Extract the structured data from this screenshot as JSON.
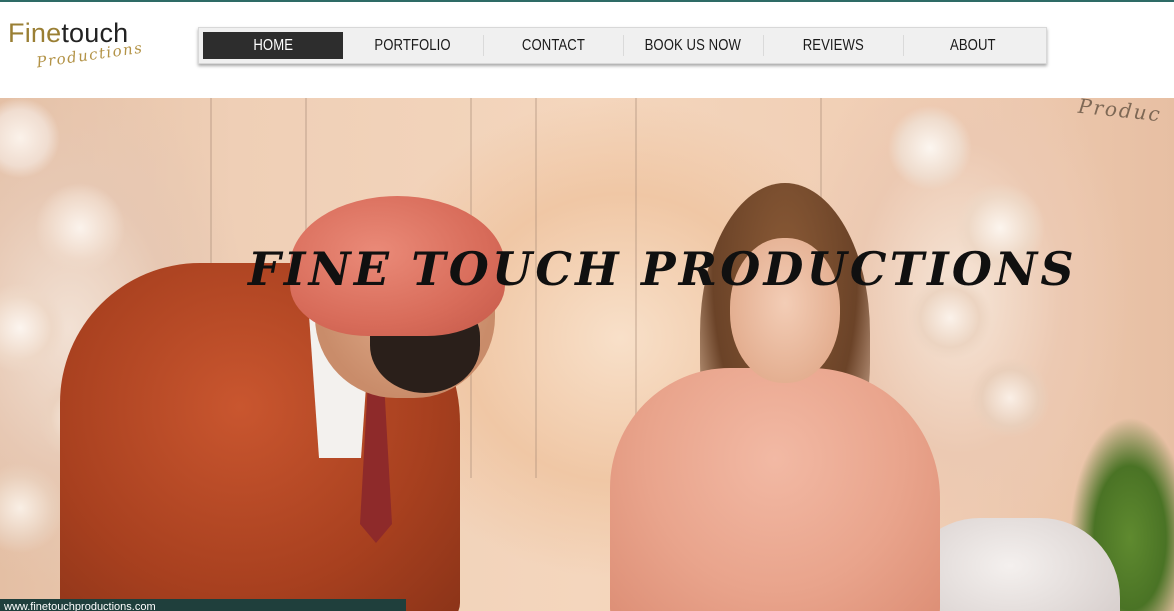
{
  "logo": {
    "primary_fine": "Fine",
    "primary_touch": "touch",
    "secondary": "Productions"
  },
  "nav": {
    "items": [
      {
        "label": "HOME",
        "active": true
      },
      {
        "label": "PORTFOLIO",
        "active": false
      },
      {
        "label": "CONTACT",
        "active": false
      },
      {
        "label": "BOOK US NOW",
        "active": false
      },
      {
        "label": "REVIEWS",
        "active": false
      },
      {
        "label": "ABOUT",
        "active": false
      }
    ]
  },
  "hero": {
    "title": "FINE TOUCH PRODUCTIONS",
    "watermark": "Produc"
  },
  "status_bar": {
    "url": "www.finetouchproductions.com"
  },
  "colors": {
    "accent_gold": "#9a7f34",
    "nav_active_bg": "#2d2d2d",
    "top_border": "#2e6b66",
    "status_bar_bg": "#1f3f3c"
  }
}
